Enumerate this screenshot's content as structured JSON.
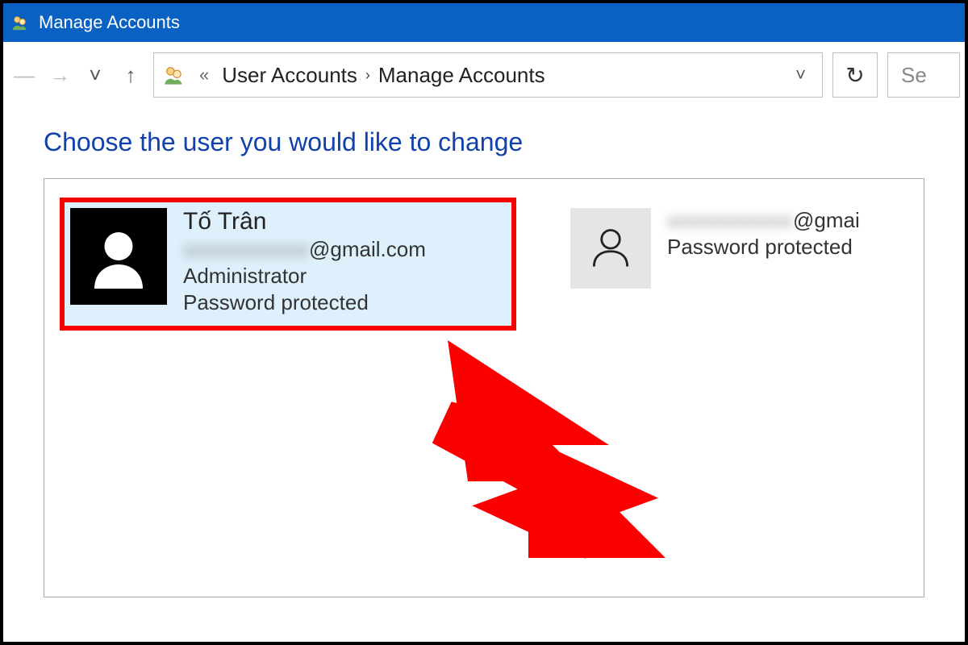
{
  "window": {
    "title": "Manage Accounts"
  },
  "nav": {
    "back_enabled": false,
    "forward_enabled": false
  },
  "breadcrumb": {
    "root": "User Accounts",
    "current": "Manage Accounts",
    "leading_chevrons": "«"
  },
  "search": {
    "placeholder": "Se"
  },
  "heading": "Choose the user you would like to change",
  "users": [
    {
      "name": "Tố Trân",
      "email_visible_suffix": "@gmail.com",
      "role": "Administrator",
      "status": "Password protected",
      "selected": true,
      "avatar_style": "dark"
    },
    {
      "name": "",
      "email_visible_suffix": "@gmai",
      "role": "",
      "status": "Password protected",
      "selected": false,
      "avatar_style": "light"
    }
  ]
}
